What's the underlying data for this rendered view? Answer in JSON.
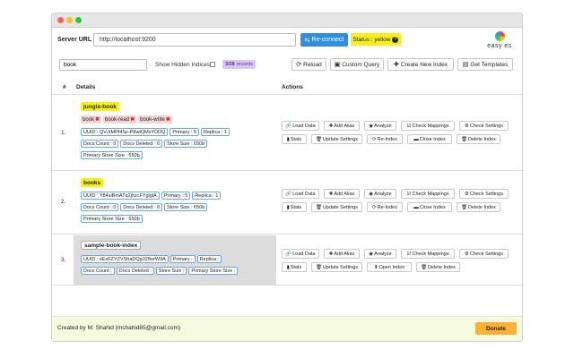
{
  "header": {
    "server_url_label": "Server URL",
    "server_url_value": "http://localhost:9200",
    "reconnect_label": "Re-connect",
    "reconnect_icon": "⇆",
    "status_label": "Status : yellow",
    "status_icon": "?",
    "logo_text": "easy es"
  },
  "toolbar": {
    "search_value": "book",
    "show_hidden_label": "Show Hidden Indices",
    "records_count": "3/28",
    "records_label": "records",
    "reload_label": "Reload",
    "custom_query_label": "Custom Query",
    "create_index_label": "Create New Index",
    "get_templates_label": "Get Templates"
  },
  "table": {
    "col_num": "#",
    "col_details": "Details",
    "col_actions": "Actions"
  },
  "rows": [
    {
      "num": "1.",
      "name": "jungle-book",
      "aliases": [
        "book",
        "book-read",
        "book-write"
      ],
      "uuid": "UUID : QVJrMPf4Sz-P8wtQMsYDDQ",
      "primary": "Primary : 5",
      "replica": "Replica : 1",
      "docs_count": "Docs Count : 0",
      "docs_deleted": "Docs Deleted : 0",
      "store_size": "Store Size : 650b",
      "primary_store_size": "Primary Store Size : 650b",
      "actions": {
        "load_data": "Load Data",
        "add_alias": "Add Alias",
        "analyze": "Analyze",
        "check_mappings": "Check Mappings",
        "check_settings": "Check Settings",
        "stats": "Stats",
        "update_settings": "Update Settings",
        "reindex": "Re-Index",
        "close_open": "Close Index",
        "delete": "Delete Index"
      }
    },
    {
      "num": "2.",
      "name": "books",
      "uuid": "UUID : Y84siBmATq2jhzcFYglgiA",
      "primary": "Primary : 5",
      "replica": "Replica : 1",
      "docs_count": "Docs Count : 0",
      "docs_deleted": "Docs Deleted : 0",
      "store_size": "Store Size : 650b",
      "primary_store_size": "Primary Store Size : 650b",
      "actions": {
        "load_data": "Load Data",
        "add_alias": "Add Alias",
        "analyze": "Analyze",
        "check_mappings": "Check Mappings",
        "check_settings": "Check Settings",
        "stats": "Stats",
        "update_settings": "Update Settings",
        "reindex": "Re-Index",
        "close_open": "Close Index",
        "delete": "Delete Index"
      }
    },
    {
      "num": "3.",
      "name": "sample-book-index",
      "uuid": "UUID : xExFZYZVShaDQg328orW9A",
      "primary": "Primary :",
      "replica": "Replica :",
      "docs_count": "Docs Count :",
      "docs_deleted": "Docs Deleted :",
      "store_size": "Store Size :",
      "primary_store_size": "Primary Store Size :",
      "actions": {
        "load_data": "Load Data",
        "add_alias": "Add Alias",
        "analyze": "Analyze",
        "check_mappings": "Check Mappings",
        "check_settings": "Check Settings",
        "stats": "Stats",
        "update_settings": "Update Settings",
        "close_open": "Open Index",
        "delete": "Delete Index"
      }
    }
  ],
  "footer": {
    "credit": "Created by M. Shahid (mshahid85@gmail.com)",
    "donate_label": "Donate"
  },
  "colors": {
    "accent_blue": "#2d8fde",
    "status_yellow": "#f6f01a",
    "alias_pink": "#f3d5d5",
    "records_purple": "#d8c6f5",
    "donate_orange": "#f9b233",
    "footer_bg": "#f5fadf"
  }
}
